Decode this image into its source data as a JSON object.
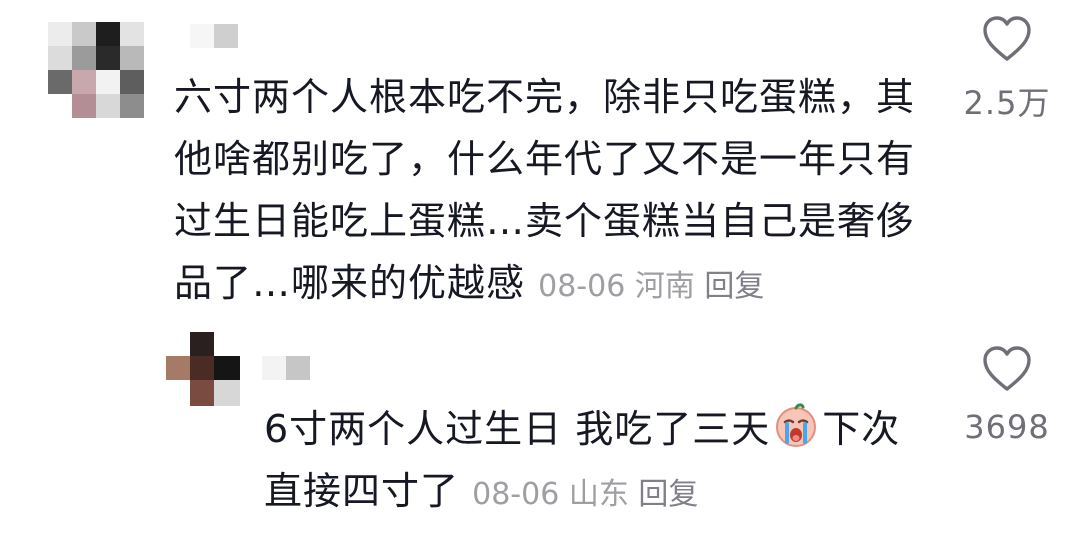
{
  "comments": [
    {
      "text": "六寸两个人根本吃不完，除非只吃蛋糕，其他啥都别吃了，什么年代了又不是一年只有过生日能吃上蛋糕…卖个蛋糕当自己是奢侈品了…哪来的优越感",
      "date": "08-06",
      "location": "河南",
      "reply_label": "回复",
      "likes": "2.5万",
      "icon": "heart-outline-icon"
    }
  ],
  "replies": [
    {
      "text_before_emoji": "6寸两个人过生日 我吃了三天",
      "emoji": "crying-face-emoji",
      "text_after_emoji": "下次直接四寸了",
      "date": "08-06",
      "location": "山东",
      "reply_label": "回复",
      "likes": "3698",
      "icon": "heart-outline-icon"
    }
  ],
  "colors": {
    "text": "#161823",
    "meta": "#9e9ea3",
    "like_count": "#6f6f77"
  }
}
